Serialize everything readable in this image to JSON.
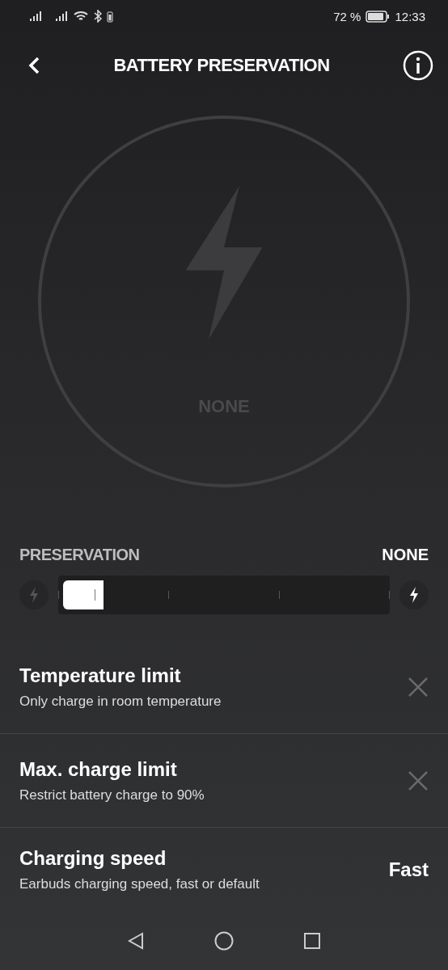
{
  "status_bar": {
    "battery": "72 %",
    "time": "12:33"
  },
  "header": {
    "title": "BATTERY PRESERVATION"
  },
  "gauge": {
    "label": "NONE"
  },
  "preservation": {
    "label": "PRESERVATION",
    "value": "NONE"
  },
  "settings": [
    {
      "kind": "toggle",
      "title": "Temperature limit",
      "subtitle": "Only charge in room temperature",
      "on": false
    },
    {
      "kind": "toggle",
      "title": "Max. charge limit",
      "subtitle": "Restrict battery charge to 90%",
      "on": false
    },
    {
      "kind": "value",
      "title": "Charging speed",
      "subtitle": "Earbuds charging speed, fast or default",
      "value": "Fast"
    }
  ]
}
